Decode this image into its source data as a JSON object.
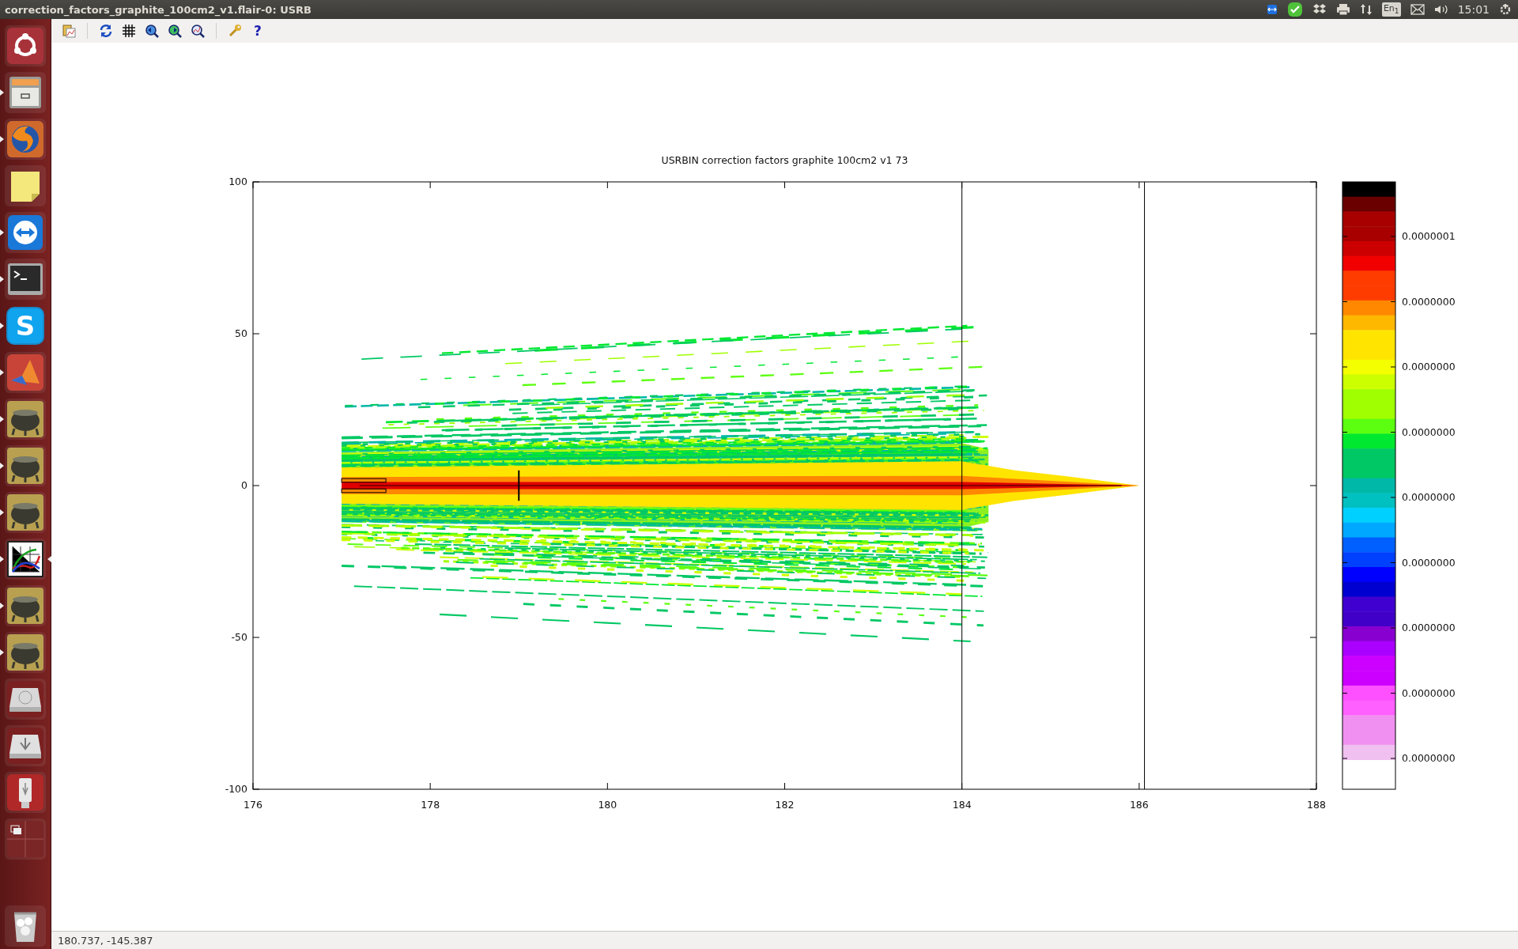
{
  "window": {
    "title": "correction_factors_graphite_100cm2_v1.flair-0: USRB"
  },
  "top_panel": {
    "keyboard_layout": "En$_{1}$",
    "clock": "15:01"
  },
  "launcher": {
    "items": [
      {
        "kind": "home",
        "running": false,
        "focused": false
      },
      {
        "kind": "files",
        "running": true,
        "focused": false
      },
      {
        "kind": "browser",
        "running": true,
        "focused": false
      },
      {
        "kind": "notes",
        "running": false,
        "focused": false
      },
      {
        "kind": "remote",
        "running": true,
        "focused": false
      },
      {
        "kind": "terminal",
        "running": true,
        "focused": false
      },
      {
        "kind": "chat",
        "running": true,
        "focused": false,
        "glyph": "S"
      },
      {
        "kind": "math",
        "running": true,
        "focused": false
      },
      {
        "kind": "cauldron",
        "running": true,
        "focused": false
      },
      {
        "kind": "cauldron",
        "running": true,
        "focused": false
      },
      {
        "kind": "cauldron",
        "running": true,
        "focused": false
      },
      {
        "kind": "plot",
        "running": true,
        "focused": true
      },
      {
        "kind": "cauldron",
        "running": true,
        "focused": false
      },
      {
        "kind": "cauldron",
        "running": true,
        "focused": false
      },
      {
        "kind": "disk",
        "running": false,
        "focused": false
      },
      {
        "kind": "usbdisk",
        "running": false,
        "focused": false
      },
      {
        "kind": "usbstick",
        "running": false,
        "focused": false
      },
      {
        "kind": "workspaces",
        "running": false,
        "focused": false
      },
      {
        "kind": "trash",
        "running": false,
        "focused": false
      }
    ]
  },
  "toolbar": {
    "help_label": "?"
  },
  "plot": {
    "title": "USRBIN correction factors graphite 100cm2 v1 73",
    "y_ticks": [
      "100",
      "50",
      "0",
      "-50",
      "-100"
    ],
    "x_ticks": [
      "176",
      "178",
      "180",
      "182",
      "184",
      "186",
      "188"
    ],
    "colorbar": {
      "bands": [
        {
          "color": "#000000"
        },
        {
          "color": "#6a0000"
        },
        {
          "color": "#a80000"
        },
        {
          "color": "#a80000"
        },
        {
          "color": "#cc0000"
        },
        {
          "color": "#f20000"
        },
        {
          "color": "#ff3c00"
        },
        {
          "color": "#ff3c00"
        },
        {
          "color": "#ff8800"
        },
        {
          "color": "#ffb800"
        },
        {
          "color": "#ffe400"
        },
        {
          "color": "#ffe400"
        },
        {
          "color": "#f4ff00"
        },
        {
          "color": "#ccff00"
        },
        {
          "color": "#a0ff00"
        },
        {
          "color": "#a0ff00"
        },
        {
          "color": "#5cff10"
        },
        {
          "color": "#00e830"
        },
        {
          "color": "#00c864"
        },
        {
          "color": "#00c864"
        },
        {
          "color": "#00b8a8"
        },
        {
          "color": "#00c0c0"
        },
        {
          "color": "#00d0ff"
        },
        {
          "color": "#00a8ff"
        },
        {
          "color": "#0060ff"
        },
        {
          "color": "#0040ff"
        },
        {
          "color": "#0000ff"
        },
        {
          "color": "#0000d0"
        },
        {
          "color": "#4000d0"
        },
        {
          "color": "#4000c8"
        },
        {
          "color": "#8800d0"
        },
        {
          "color": "#aa00ff"
        },
        {
          "color": "#cc00ff"
        },
        {
          "color": "#cc00ff"
        },
        {
          "color": "#ff50ff"
        },
        {
          "color": "#ff60ff"
        },
        {
          "color": "#f090f0"
        },
        {
          "color": "#f090f0"
        },
        {
          "color": "#f0c0f0"
        }
      ],
      "labels": [
        "0.0000001",
        "0.0000000",
        "0.0000000",
        "0.0000000",
        "0.0000000",
        "0.0000000",
        "0.0000000",
        "0.0000000",
        "0.0000000"
      ]
    }
  },
  "status_bar": {
    "coordinates": "180.737, -145.387"
  }
}
